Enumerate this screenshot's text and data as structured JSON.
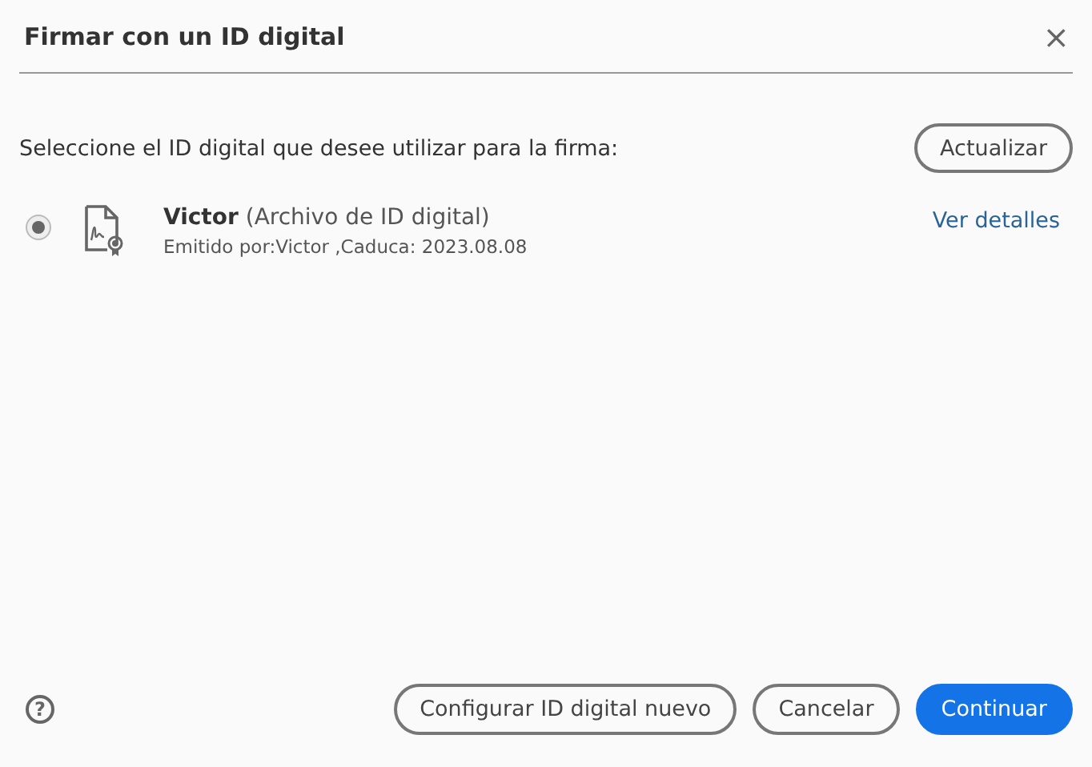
{
  "window": {
    "title": "Firmar con un ID digital",
    "close": "×"
  },
  "prompt": "Seleccione el ID digital que desee utilizar para la firma:",
  "refresh_button": "Actualizar",
  "ids": [
    {
      "name": "**Victor** (Archivo de ID digital)",
      "detail": "Emitido por:Victor ,Caduca: 2023.08.08",
      "link": "Ver detalles",
      "selected": true
    }
  ],
  "help": "?",
  "buttons": [
    {
      "label": "Configurar ID digital nuevo",
      "kind": "secondary"
    },
    {
      "label": "Cancelar",
      "kind": "secondary"
    },
    {
      "label": "Continuar",
      "kind": "primary"
    }
  ]
}
